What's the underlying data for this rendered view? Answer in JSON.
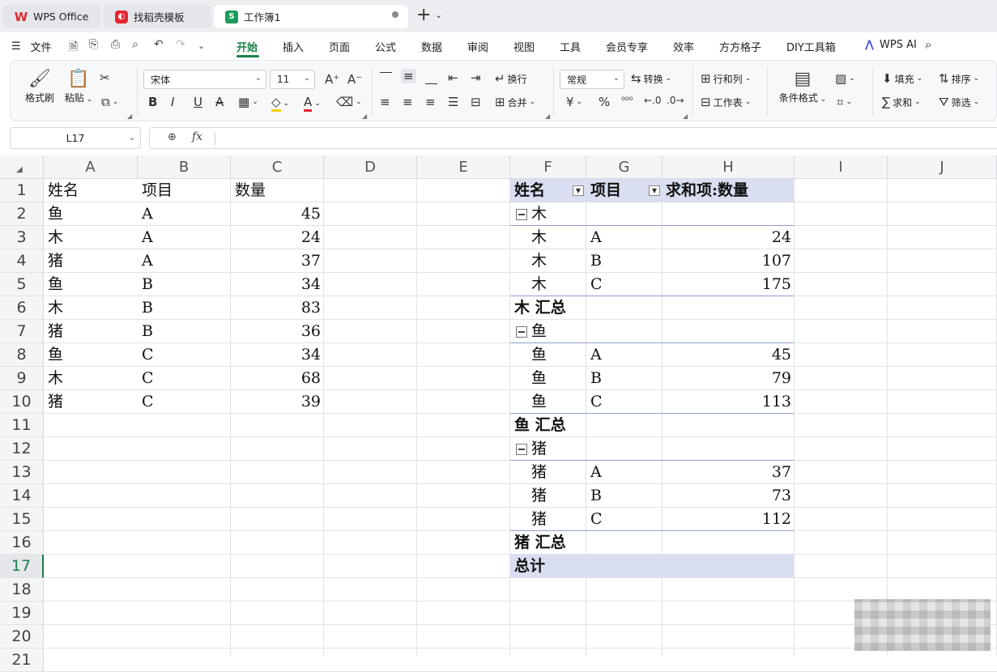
{
  "window": {
    "tabs": [
      {
        "label": "WPS Office"
      },
      {
        "label": "找稻壳模板"
      },
      {
        "label": "工作簿1"
      }
    ],
    "new_tab_label": "+"
  },
  "menu": {
    "file_label": "文件",
    "items": [
      "开始",
      "插入",
      "页面",
      "公式",
      "数据",
      "审阅",
      "视图",
      "工具",
      "会员专享",
      "效率",
      "方方格子",
      "DIY工具箱"
    ],
    "active": "开始",
    "wps_ai_label": "WPS AI"
  },
  "ribbon": {
    "format_painter": "格式刷",
    "paste": "粘贴",
    "font_name": "宋体",
    "font_size": "11",
    "wrap": "换行",
    "merge": "合并",
    "number_format": "常规",
    "convert": "转换",
    "rows_cols": "行和列",
    "worksheet": "工作表",
    "conditional_format": "条件格式",
    "fill": "填充",
    "sort": "排序",
    "sum": "求和",
    "filter": "筛选",
    "currency_symbol": "¥",
    "percent_symbol": "%"
  },
  "formula_bar": {
    "name_box": "L17",
    "fx_label": "fx",
    "formula": ""
  },
  "sheet": {
    "columns": [
      "A",
      "B",
      "C",
      "D",
      "E",
      "F",
      "G",
      "H",
      "I",
      "J"
    ],
    "rows": [
      "1",
      "2",
      "3",
      "4",
      "5",
      "6",
      "7",
      "8",
      "9",
      "10",
      "11",
      "12",
      "13",
      "14",
      "15",
      "16",
      "17",
      "18",
      "19",
      "20",
      "21"
    ],
    "selected_row": "17",
    "source_header": [
      "姓名",
      "项目",
      "数量"
    ],
    "source_rows": [
      [
        "鱼",
        "A",
        "45"
      ],
      [
        "木",
        "A",
        "24"
      ],
      [
        "猪",
        "A",
        "37"
      ],
      [
        "鱼",
        "B",
        "34"
      ],
      [
        "木",
        "B",
        "83"
      ],
      [
        "猪",
        "B",
        "36"
      ],
      [
        "鱼",
        "C",
        "34"
      ],
      [
        "木",
        "C",
        "68"
      ],
      [
        "猪",
        "C",
        "39"
      ]
    ]
  },
  "pivot": {
    "header": [
      "姓名",
      "项目",
      "求和项:数量"
    ],
    "groups": [
      {
        "name": "木",
        "rows": [
          [
            "木",
            "A",
            "24"
          ],
          [
            "木",
            "B",
            "107"
          ],
          [
            "木",
            "C",
            "175"
          ]
        ],
        "subtotal_label": "木 汇总"
      },
      {
        "name": "鱼",
        "rows": [
          [
            "鱼",
            "A",
            "45"
          ],
          [
            "鱼",
            "B",
            "79"
          ],
          [
            "鱼",
            "C",
            "113"
          ]
        ],
        "subtotal_label": "鱼 汇总"
      },
      {
        "name": "猪",
        "rows": [
          [
            "猪",
            "A",
            "37"
          ],
          [
            "猪",
            "B",
            "73"
          ],
          [
            "猪",
            "C",
            "112"
          ]
        ],
        "subtotal_label": "猪 汇总"
      }
    ],
    "grand_total_label": "总计",
    "header_color": "#d9dff1"
  },
  "colors": {
    "accent_green": "#1a7f47",
    "wps_red": "#e3262f",
    "sheet_icon_green": "#1d9a5b"
  }
}
